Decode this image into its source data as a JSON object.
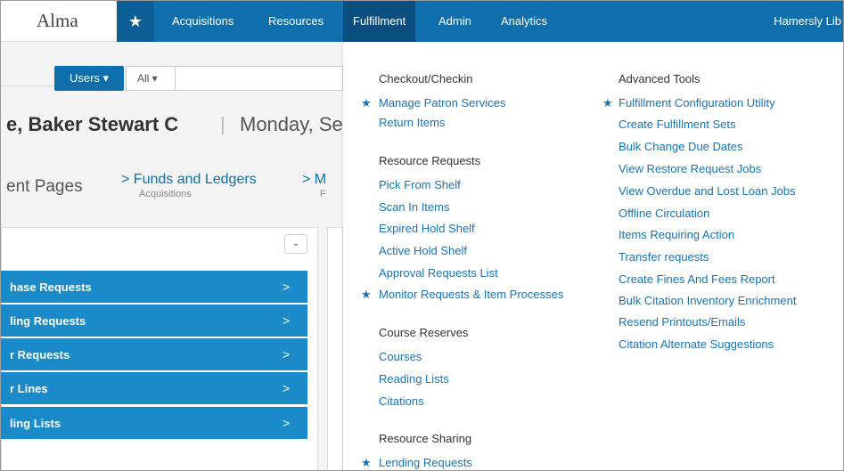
{
  "app": {
    "logo": "Alma"
  },
  "nav": {
    "star_icon": "★",
    "items": [
      "Acquisitions",
      "Resources",
      "Fulfillment",
      "Admin",
      "Analytics"
    ],
    "active": "Fulfillment",
    "user": "Hamersly Lib"
  },
  "search": {
    "scope_label": "Users ▾",
    "filter_label": "All ▾",
    "value": ""
  },
  "heading": {
    "name": "e, Baker Stewart C",
    "separator": "|",
    "date": "Monday, Se"
  },
  "recent": {
    "label": "ent Pages",
    "crumbs": [
      {
        "title": "> Funds and Ledgers",
        "sub": "Acquisitions"
      },
      {
        "title": "> M",
        "sub": "F"
      }
    ]
  },
  "panel": {
    "chevron": "⌄",
    "items": [
      "hase Requests",
      "ling Requests",
      "r Requests",
      "r Lines",
      "ling Lists"
    ],
    "item_chevron": ">"
  },
  "menu": {
    "star": "★",
    "left": {
      "sections": [
        {
          "heading": "Checkout/Checkin",
          "links": [
            {
              "label": "Manage Patron Services",
              "fav": true
            },
            {
              "label": "Return Items",
              "fav": false
            }
          ]
        },
        {
          "heading": "Resource Requests",
          "links": [
            {
              "label": "Pick From Shelf",
              "fav": false
            },
            {
              "label": "Scan In Items",
              "fav": false
            },
            {
              "label": "Expired Hold Shelf",
              "fav": false
            },
            {
              "label": "Active Hold Shelf",
              "fav": false
            },
            {
              "label": "Approval Requests List",
              "fav": false
            },
            {
              "label": "Monitor Requests & Item Processes",
              "fav": true
            }
          ]
        },
        {
          "heading": "Course Reserves",
          "links": [
            {
              "label": "Courses",
              "fav": false
            },
            {
              "label": "Reading Lists",
              "fav": false
            },
            {
              "label": "Citations",
              "fav": false
            }
          ]
        },
        {
          "heading": "Resource Sharing",
          "links": [
            {
              "label": "Lending Requests",
              "fav": true
            }
          ]
        }
      ]
    },
    "right": {
      "sections": [
        {
          "heading": "Advanced Tools",
          "links": [
            {
              "label": "Fulfillment Configuration Utility",
              "fav": true
            },
            {
              "label": "Create Fulfillment Sets",
              "fav": false
            },
            {
              "label": "Bulk Change Due Dates",
              "fav": false
            },
            {
              "label": "View Restore Request Jobs",
              "fav": false
            },
            {
              "label": "View Overdue and Lost Loan Jobs",
              "fav": false
            },
            {
              "label": "Offline Circulation",
              "fav": false
            },
            {
              "label": "Items Requiring Action",
              "fav": false
            },
            {
              "label": "Transfer requests",
              "fav": false
            },
            {
              "label": "Create Fines And Fees Report",
              "fav": false
            },
            {
              "label": "Bulk Citation Inventory Enrichment",
              "fav": false
            },
            {
              "label": "Resend Printouts/Emails",
              "fav": false
            },
            {
              "label": "Citation Alternate Suggestions",
              "fav": false
            }
          ]
        }
      ]
    }
  }
}
